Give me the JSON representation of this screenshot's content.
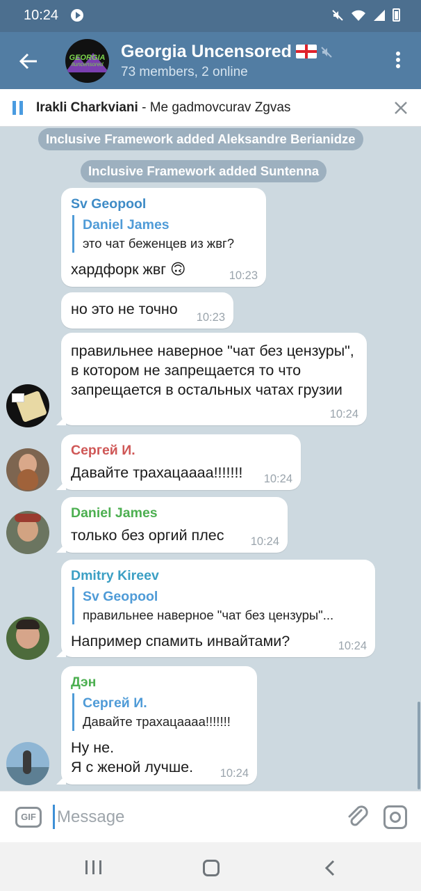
{
  "status_bar": {
    "time": "10:24"
  },
  "header": {
    "title": "Georgia Uncensored",
    "subtitle": "73 members, 2 online",
    "avatar_text": "GEORGIA",
    "avatar_subtext": "#uncensored"
  },
  "pinned": {
    "author": "Irakli Charkviani",
    "separator": " - ",
    "text": "Me gadmovcurav Zgvas"
  },
  "service_messages": [
    "Inclusive Framework added Aleksandre Berianidze",
    "Inclusive Framework added Suntenna"
  ],
  "messages": [
    {
      "sender": "Sv Geopool",
      "sender_color": "#3e8bc6",
      "reply_name": "Daniel James",
      "reply_text": "это чат беженцев из жвг?",
      "text": "хардфорк жвг 🙃",
      "time": "10:23"
    },
    {
      "text": "но это не точно",
      "time": "10:23"
    },
    {
      "text": "правильнее наверное \"чат без цензуры\", в котором не запрещается то что запрещается в остальных чатах грузии",
      "time": "10:24"
    },
    {
      "sender": "Сергей И.",
      "sender_color": "#cf5756",
      "text": "Давайте трахацаааа!!!!!!!",
      "time": "10:24"
    },
    {
      "sender": "Daniel James",
      "sender_color": "#4caf50",
      "text": "только без оргий плес",
      "time": "10:24"
    },
    {
      "sender": "Dmitry Kireev",
      "sender_color": "#3b9fc4",
      "reply_name": "Sv Geopool",
      "reply_text": "правильнее наверное \"чат без цензуры\"...",
      "text": "Например спамить инвайтами?",
      "time": "10:24"
    },
    {
      "sender": "Дэн",
      "sender_color": "#4caf50",
      "reply_name": "Сергей И.",
      "reply_text": "Давайте трахацаааа!!!!!!!",
      "text_line1": "Ну не.",
      "text_line2": "Я с женой лучше.",
      "time": "10:24"
    }
  ],
  "input": {
    "placeholder": "Message",
    "gif_label": "GIF"
  },
  "colors": {
    "header_bg": "#527da3",
    "status_bg": "#4c6f8f",
    "chat_bg": "#cdd9e0",
    "accent": "#4f9bd7"
  }
}
